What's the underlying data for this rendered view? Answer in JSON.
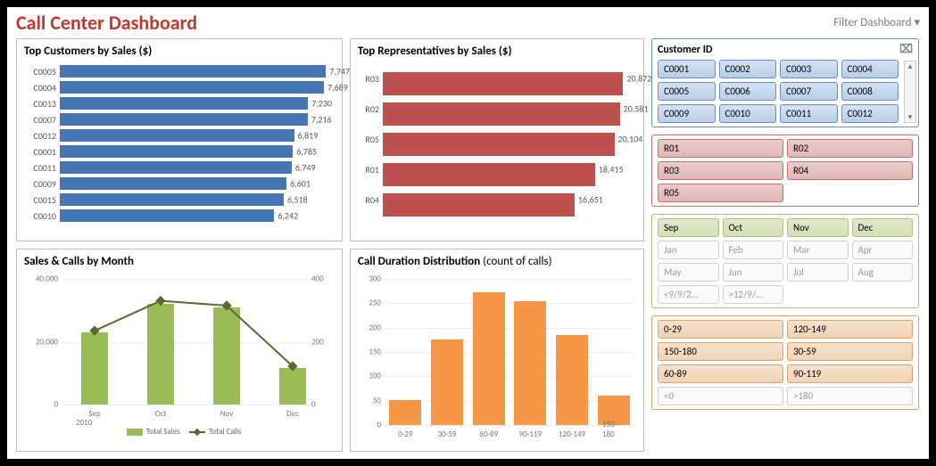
{
  "title": "Call Center Dashboard",
  "filter_label": "Filter Dashboard",
  "panels": {
    "customers": {
      "title": "Top Customers by Sales ($)"
    },
    "reps": {
      "title": "Top Representatives by Sales ($)"
    },
    "monthly": {
      "title": "Sales & Calls by Month"
    },
    "duration": {
      "title_main": "Call Duration Distribution",
      "title_sub": " (count of calls)"
    }
  },
  "legend": {
    "sales": "Total Sales",
    "calls": "Total Calls"
  },
  "slicers": {
    "customer": {
      "title": "Customer ID",
      "items": [
        "C0001",
        "C0002",
        "C0003",
        "C0004",
        "C0005",
        "C0006",
        "C0007",
        "C0008",
        "C0009",
        "C0010",
        "C0011",
        "C0012"
      ]
    },
    "rep": {
      "items": [
        "R01",
        "R02",
        "R03",
        "R04",
        "R05"
      ]
    },
    "month": {
      "active": [
        "Sep",
        "Oct",
        "Nov",
        "Dec"
      ],
      "dim": [
        "Jan",
        "Feb",
        "Mar",
        "Apr",
        "May",
        "Jun",
        "Jul",
        "Aug",
        "<9/9/2...",
        ">12/9/..."
      ]
    },
    "duration": {
      "active": [
        "0-29",
        "120-149",
        "150-180",
        "30-59",
        "60-89",
        "90-119"
      ],
      "dim": [
        "<0",
        ">180"
      ]
    }
  },
  "monthly_year": "2010",
  "chart_data": [
    {
      "type": "bar",
      "name": "top_customers",
      "title": "Top Customers by Sales ($)",
      "orientation": "horizontal",
      "categories": [
        "C0005",
        "C0004",
        "C0013",
        "C0007",
        "C0012",
        "C0001",
        "C0011",
        "C0009",
        "C0015",
        "C0010"
      ],
      "values": [
        7747,
        7689,
        7230,
        7216,
        6819,
        6785,
        6749,
        6601,
        6518,
        6242
      ],
      "xlim": [
        0,
        8000
      ]
    },
    {
      "type": "bar",
      "name": "top_reps",
      "title": "Top Representatives by Sales ($)",
      "orientation": "horizontal",
      "categories": [
        "R03",
        "R02",
        "R05",
        "R01",
        "R04"
      ],
      "values": [
        20872,
        20581,
        20104,
        18415,
        16651
      ],
      "xlim": [
        0,
        22000
      ]
    },
    {
      "type": "bar+line",
      "name": "sales_calls_by_month",
      "title": "Sales & Calls by Month",
      "categories": [
        "Sep",
        "Oct",
        "Nov",
        "Dec"
      ],
      "series": [
        {
          "name": "Total Sales",
          "axis": "left",
          "kind": "bar",
          "values": [
            23000,
            32000,
            31000,
            11500
          ]
        },
        {
          "name": "Total Calls",
          "axis": "right",
          "kind": "line",
          "values": [
            235,
            330,
            315,
            122
          ]
        }
      ],
      "ylim_left": [
        0,
        40000
      ],
      "ylim_right": [
        0,
        400
      ],
      "xlabel_sub": "2010"
    },
    {
      "type": "bar",
      "name": "call_duration_distribution",
      "title": "Call Duration Distribution (count of calls)",
      "categories": [
        "0-29",
        "30-59",
        "60-89",
        "90-119",
        "120-149",
        "150-180"
      ],
      "values": [
        52,
        175,
        272,
        255,
        185,
        60
      ],
      "ylim": [
        0,
        300
      ]
    }
  ]
}
